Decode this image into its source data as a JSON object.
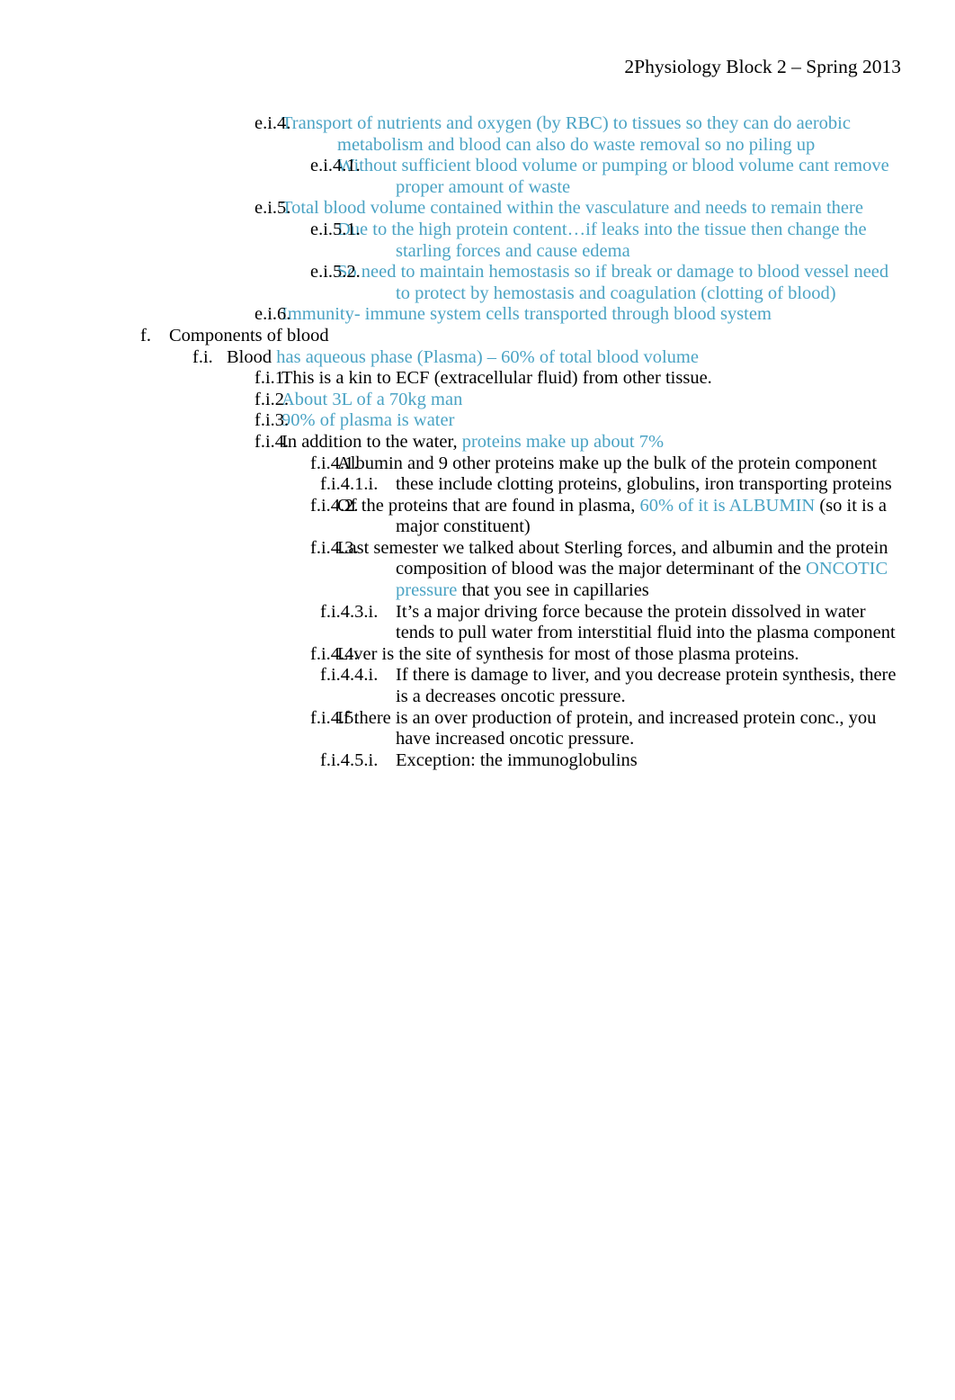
{
  "header": {
    "title": "2Physiology Block 2 – Spring 2013"
  },
  "colors": {
    "text_black": "#000000",
    "text_blue": "#4aa3c4",
    "page_background": "#ffffff"
  },
  "outline": [
    {
      "id": "e-i-4",
      "level": "ein",
      "marker": "e.i.4.",
      "runs": [
        {
          "text": "Transport of nutrients and oxygen (by RBC) to tissues so they can do aerobic metabolism and blood can also do waste removal so no piling up",
          "color": "blue"
        }
      ]
    },
    {
      "id": "e-i-4-1",
      "level": "einm",
      "marker": "e.i.4.1.",
      "runs": [
        {
          "text": "Without sufficient blood volume or pumping or blood volume cant remove proper amount of waste",
          "color": "blue"
        }
      ]
    },
    {
      "id": "e-i-5",
      "level": "ein",
      "marker": "e.i.5.",
      "runs": [
        {
          "text": "Total blood volume contained within the vasculature and needs to remain there",
          "color": "blue"
        }
      ]
    },
    {
      "id": "e-i-5-1",
      "level": "einm",
      "marker": "e.i.5.1.",
      "runs": [
        {
          "text": "Due to the high protein content…if leaks into the tissue then change the starling forces and cause edema",
          "color": "blue"
        }
      ]
    },
    {
      "id": "e-i-5-2",
      "level": "einm",
      "marker": "e.i.5.2.",
      "runs": [
        {
          "text": "So need to maintain hemostasis so if break or damage to blood vessel need to protect by hemostasis and coagulation (clotting of blood)",
          "color": "blue"
        }
      ]
    },
    {
      "id": "e-i-6",
      "level": "ein",
      "marker": "e.i.6.",
      "runs": [
        {
          "text": "Immunity- immune system cells transported through blood system",
          "color": "blue"
        }
      ]
    },
    {
      "id": "f",
      "level": "f",
      "marker": "f.",
      "runs": [
        {
          "text": "Components of blood",
          "color": "black"
        }
      ]
    },
    {
      "id": "f-i",
      "level": "fi",
      "marker": "f.i.",
      "runs": [
        {
          "text": "Blood ",
          "color": "black"
        },
        {
          "text": "has aqueous phase (Plasma)   – 60% of total blood volume",
          "color": "blue"
        }
      ]
    },
    {
      "id": "f-i-1",
      "level": "fin",
      "marker": "f.i.1.",
      "runs": [
        {
          "text": "This is a kin to ECF (extracellular fluid) from other tissue.",
          "color": "black"
        }
      ]
    },
    {
      "id": "f-i-2",
      "level": "fin",
      "marker": "f.i.2.",
      "runs": [
        {
          "text": "About 3L of a 70kg man",
          "color": "blue"
        }
      ]
    },
    {
      "id": "f-i-3",
      "level": "fin",
      "marker": "f.i.3.",
      "runs": [
        {
          "text": "90% of plasma is water",
          "color": "blue"
        }
      ]
    },
    {
      "id": "f-i-4",
      "level": "fin",
      "marker": "f.i.4.",
      "runs": [
        {
          "text": "In addition to the water, ",
          "color": "black"
        },
        {
          "text": "proteins make up about 7%",
          "color": "blue"
        }
      ]
    },
    {
      "id": "f-i-4-1",
      "level": "finm",
      "marker": "f.i.4.1.",
      "runs": [
        {
          "text": "Albumin and 9 other proteins make up the bulk of the protein component",
          "color": "black"
        }
      ]
    },
    {
      "id": "f-i-4-1-i",
      "level": "finmi",
      "marker": "f.i.4.1.i.",
      "runs": [
        {
          "text": "these include clotting proteins, globulins, iron transporting proteins",
          "color": "black"
        }
      ]
    },
    {
      "id": "f-i-4-2",
      "level": "finm",
      "marker": "f.i.4.2.",
      "runs": [
        {
          "text": "Of the proteins that are found in plasma, ",
          "color": "black"
        },
        {
          "text": "60% of it is  ALBUMIN",
          "color": "blue"
        },
        {
          "text": " (so it is a major constituent)",
          "color": "black"
        }
      ]
    },
    {
      "id": "f-i-4-3",
      "level": "finm",
      "marker": "f.i.4.3.",
      "runs": [
        {
          "text": "Last semester we talked about Sterling forces, and albumin and the protein composition of blood was the major determinant of the ",
          "color": "black"
        },
        {
          "text": "ONCOTIC pressure",
          "color": "blue"
        },
        {
          "text": "   that you see in capillaries",
          "color": "black"
        }
      ]
    },
    {
      "id": "f-i-4-3-i",
      "level": "finmi",
      "marker": "f.i.4.3.i.",
      "runs": [
        {
          "text": "It’s a major driving force because the protein dissolved in water tends to pull water from interstitial fluid into the  plasma component",
          "color": "black"
        }
      ]
    },
    {
      "id": "f-i-4-4",
      "level": "finm",
      "marker": "f.i.4.4.",
      "runs": [
        {
          "text": "Liver  is the site of synthesis for most of those plasma proteins.",
          "color": "black"
        }
      ]
    },
    {
      "id": "f-i-4-4-i",
      "level": "finmi",
      "marker": "f.i.4.4.i.",
      "runs": [
        {
          "text": "If there is damage to liver, and you decrease protein synthesis, there is a decreases oncotic pressure.",
          "color": "black"
        }
      ]
    },
    {
      "id": "f-i-4-5",
      "level": "finm",
      "marker": "f.i.4.5.",
      "runs": [
        {
          "text": "If there is an over production of protein, and increased protein conc., you have increased oncotic pressure.",
          "color": "black"
        }
      ]
    },
    {
      "id": "f-i-4-5-i",
      "level": "finmi",
      "marker": "f.i.4.5.i.",
      "runs": [
        {
          "text": "Exception: the immunoglobulins",
          "color": "black"
        }
      ]
    }
  ]
}
